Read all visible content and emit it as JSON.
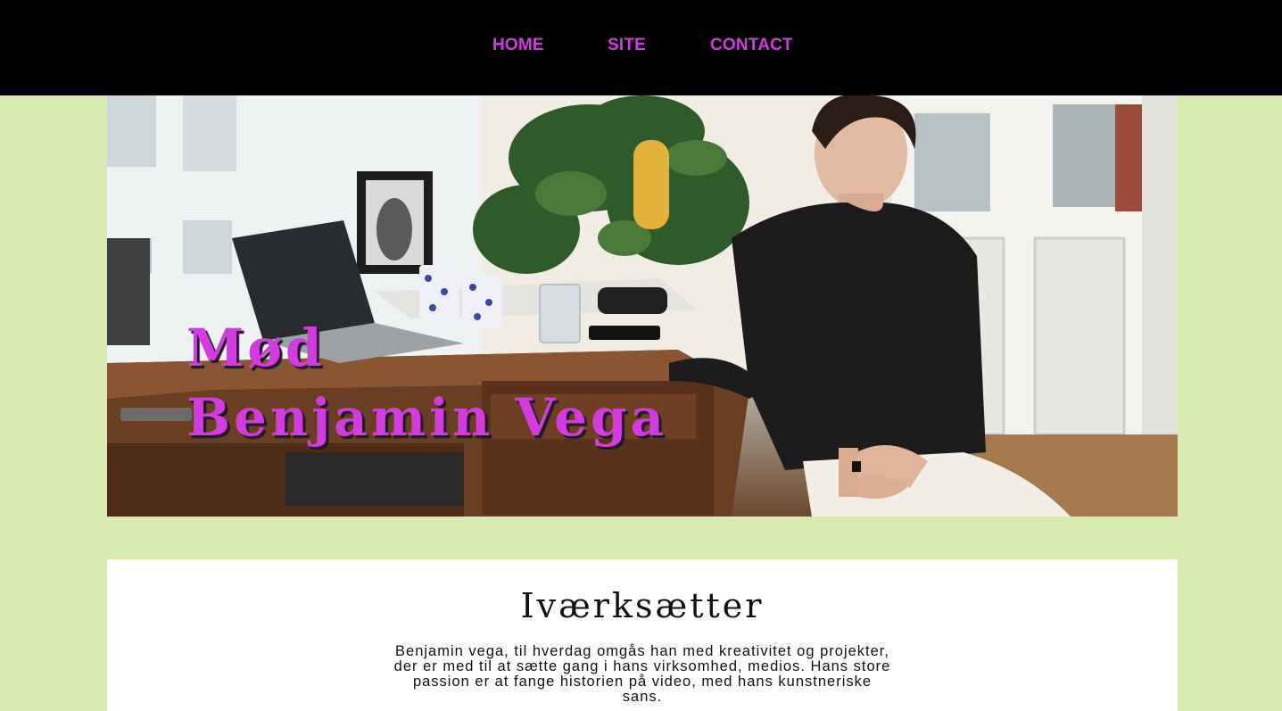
{
  "nav": {
    "items": [
      {
        "label": "HOME"
      },
      {
        "label": "SITE"
      },
      {
        "label": "CONTACT"
      }
    ]
  },
  "hero": {
    "title_line1": "Mød",
    "title_line2": "Benjamin Vega"
  },
  "intro": {
    "heading": "Iværksætter",
    "body": "Benjamin vega, til hverdag omgås han med kreativitet og projekter, der er med til at sætte gang i hans virksomhed, medios. Hans store passion er at fange historien på video, med hans kunstneriske sans."
  },
  "colors": {
    "page_bg": "#d9eab0",
    "nav_bg": "#000000",
    "accent": "#d23be0",
    "card_bg": "#ffffff"
  }
}
